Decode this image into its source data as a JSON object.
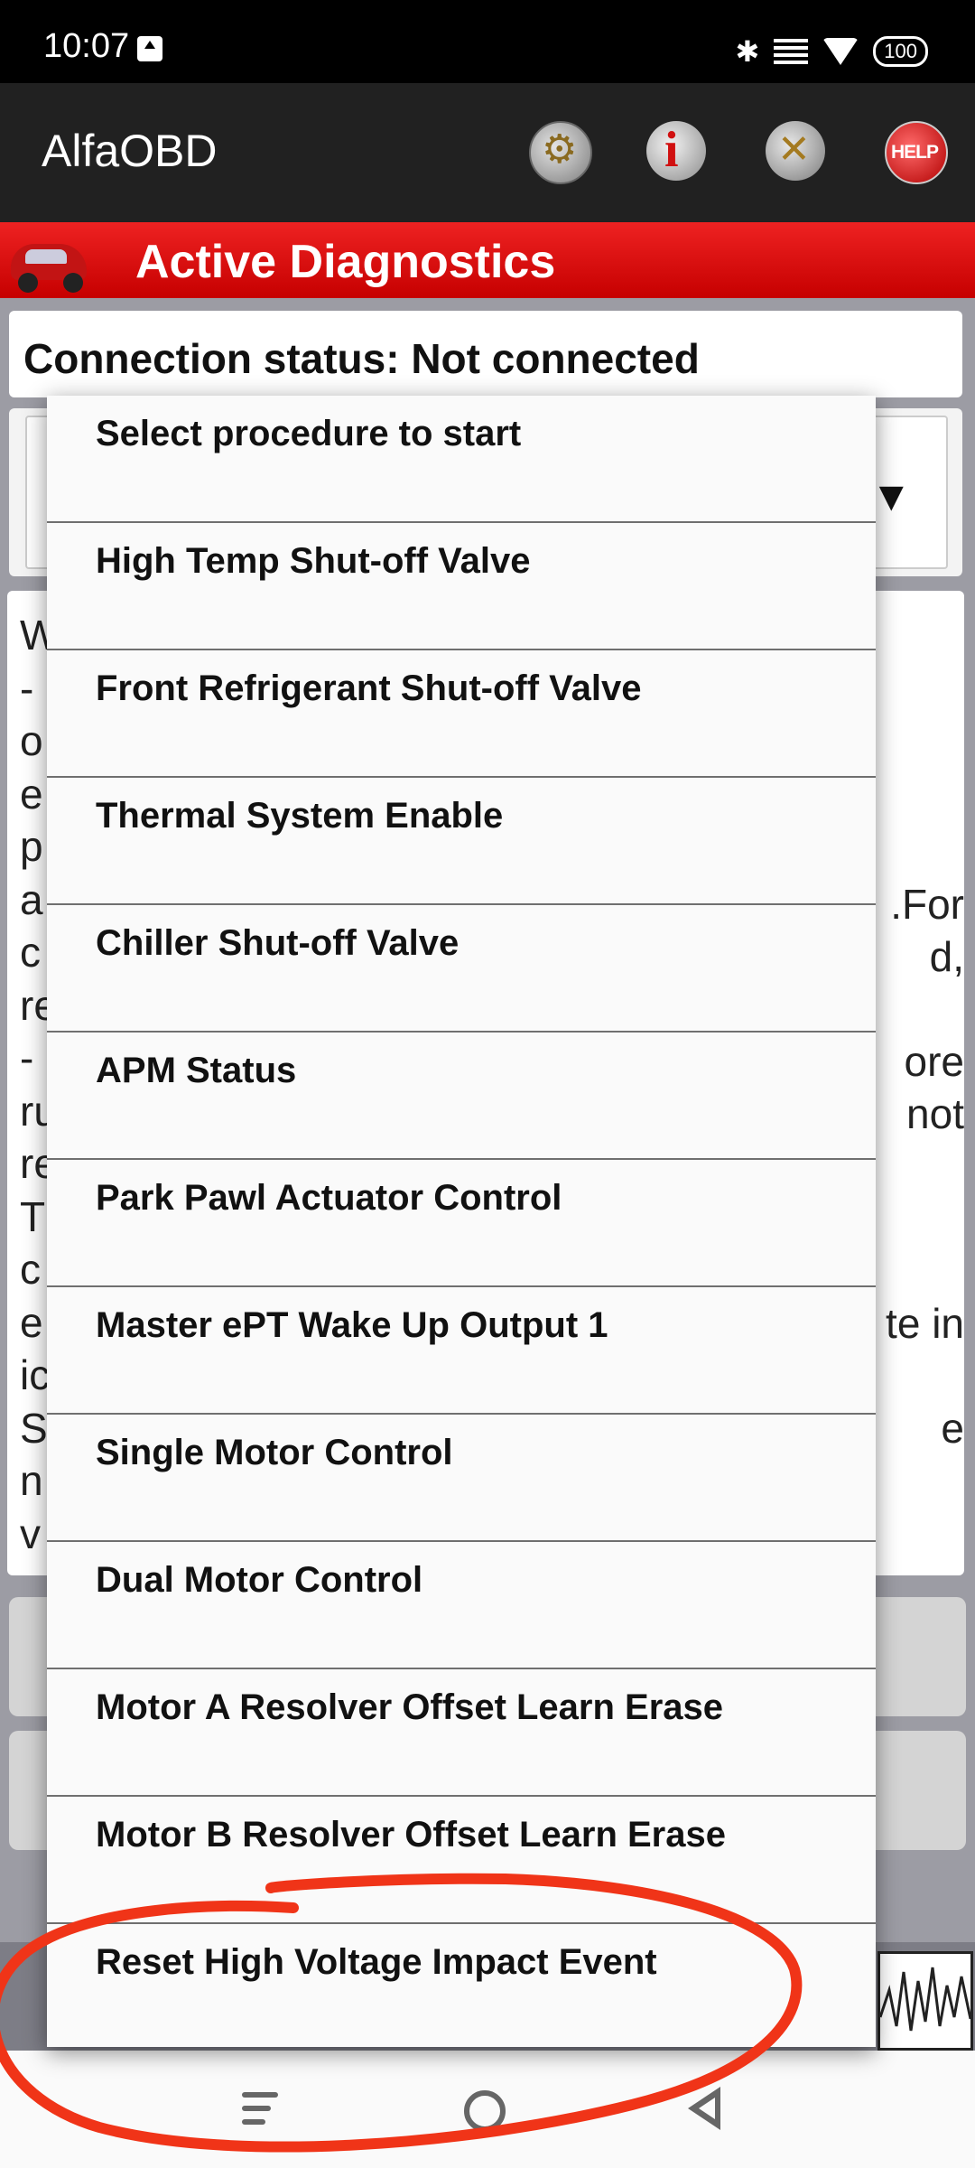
{
  "status_bar": {
    "time": "10:07",
    "battery": "100"
  },
  "app_bar": {
    "title": "AlfaOBD",
    "help_label": "HELP"
  },
  "screen": {
    "title": "Active Diagnostics"
  },
  "connection": {
    "status": "Connection status: Not connected"
  },
  "procedure_dropdown": {
    "arrow": "▼"
  },
  "description_fragments": {
    "left": [
      "W",
      "-",
      "o",
      "e",
      "p",
      "a",
      "c",
      "re",
      "-",
      "ru",
      "re",
      "T",
      "c",
      "e",
      "ic",
      "S",
      "n",
      "v"
    ],
    "right": [
      ".For",
      "d,",
      "ore",
      "not",
      "te in",
      "e"
    ]
  },
  "procedure_menu": {
    "items": [
      "Select procedure to start",
      "High Temp Shut-off Valve",
      "Front Refrigerant Shut-off Valve",
      "Thermal System Enable",
      "Chiller Shut-off Valve",
      "APM Status",
      "Park Pawl Actuator Control",
      "Master ePT Wake Up Output 1",
      "Single Motor Control",
      "Dual Motor Control",
      "Motor A Resolver Offset Learn Erase",
      "Motor B Resolver Offset Learn Erase",
      "Reset High Voltage Impact Event"
    ]
  },
  "colors": {
    "header_red": "#d60000",
    "annotation_red": "#f03418",
    "app_bar": "#212121"
  }
}
